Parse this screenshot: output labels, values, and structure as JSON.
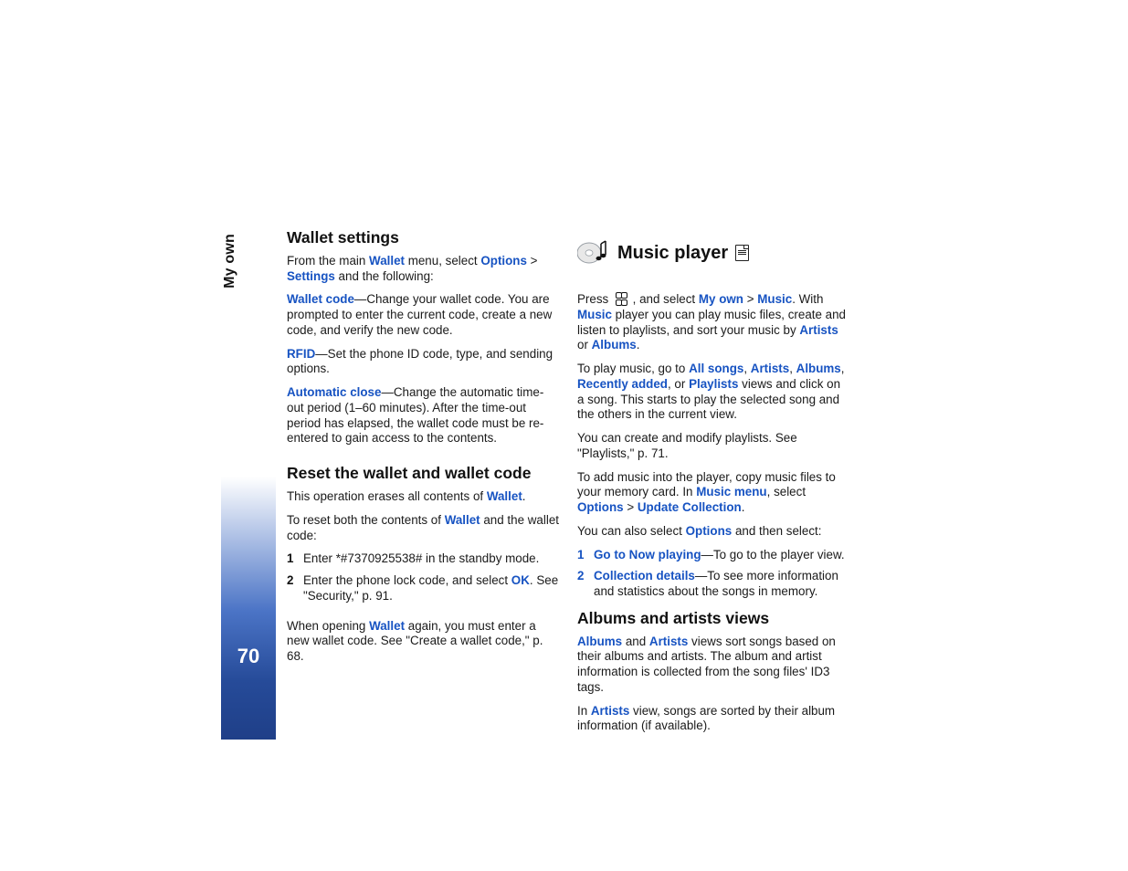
{
  "sidebar": {
    "section_label": "My own",
    "page_number": "70"
  },
  "left": {
    "wallet_settings_heading": "Wallet settings",
    "p1_a": "From the main ",
    "p1_b": "Wallet",
    "p1_c": " menu, select ",
    "p1_d": "Options",
    "p1_e": " > ",
    "p1_f": "Settings",
    "p1_g": " and the following:",
    "p2_a": "Wallet code",
    "p2_b": "—Change your wallet code. You are prompted to enter the current code, create a new code, and verify the new code.",
    "p3_a": "RFID",
    "p3_b": "—Set the phone ID code, type, and sending options.",
    "p4_a": "Automatic close",
    "p4_b": "—Change the automatic time-out period (1–60 minutes). After the time-out period has elapsed, the wallet code must be re-entered to gain access to the contents.",
    "reset_heading": "Reset the wallet and wallet code",
    "p5_a": "This operation erases all contents of ",
    "p5_b": "Wallet",
    "p5_c": ".",
    "p6_a": "To reset both the contents of ",
    "p6_b": "Wallet",
    "p6_c": " and the wallet code:",
    "step1": "Enter *#7370925538# in the standby mode.",
    "step2_a": "Enter the phone lock code, and select ",
    "step2_b": "OK",
    "step2_c": ". See \"Security,\" p. 91.",
    "p7_a": "When opening ",
    "p7_b": "Wallet",
    "p7_c": " again, you must enter a new wallet code. See \"Create a wallet code,\" p. 68."
  },
  "right": {
    "music_player_heading": "Music player",
    "p1_a": "Press ",
    "p1_b": " , and select ",
    "p1_c": "My own",
    "p1_d": " > ",
    "p1_e": "Music",
    "p1_f": ". With ",
    "p1_g": "Music",
    "p1_h": " player you can play music files, create and listen to playlists, and sort your music by ",
    "p1_i": "Artists",
    "p1_j": " or ",
    "p1_k": "Albums",
    "p1_l": ".",
    "p2_a": "To play music, go to ",
    "p2_b": "All songs",
    "p2_c": ", ",
    "p2_d": "Artists",
    "p2_e": ", ",
    "p2_f": "Albums",
    "p2_g": ", ",
    "p2_h": "Recently added",
    "p2_i": ", or ",
    "p2_j": "Playlists",
    "p2_k": " views and click on a song. This starts to play the selected song and the others in the current view.",
    "p3": "You can create and modify playlists. See \"Playlists,\" p. 71.",
    "p4_a": "To add music into the player, copy music files to your memory card. In ",
    "p4_b": "Music menu",
    "p4_c": ", select ",
    "p4_d": "Options",
    "p4_e": " > ",
    "p4_f": "Update Collection",
    "p4_g": ".",
    "p5_a": "You can also select ",
    "p5_b": "Options",
    "p5_c": " and then select:",
    "opt1_a": "Go to Now playing",
    "opt1_b": "—To go to the player view.",
    "opt2_a": "Collection details",
    "opt2_b": "—To see more information and statistics about the songs in memory.",
    "albums_heading": "Albums and artists views",
    "p6_a": "Albums",
    "p6_b": " and ",
    "p6_c": "Artists",
    "p6_d": " views sort songs based on their albums and artists. The album and artist information is collected from the song files' ID3 tags.",
    "p7_a": "In ",
    "p7_b": "Artists",
    "p7_c": " view, songs are sorted by their album information (if available)."
  }
}
